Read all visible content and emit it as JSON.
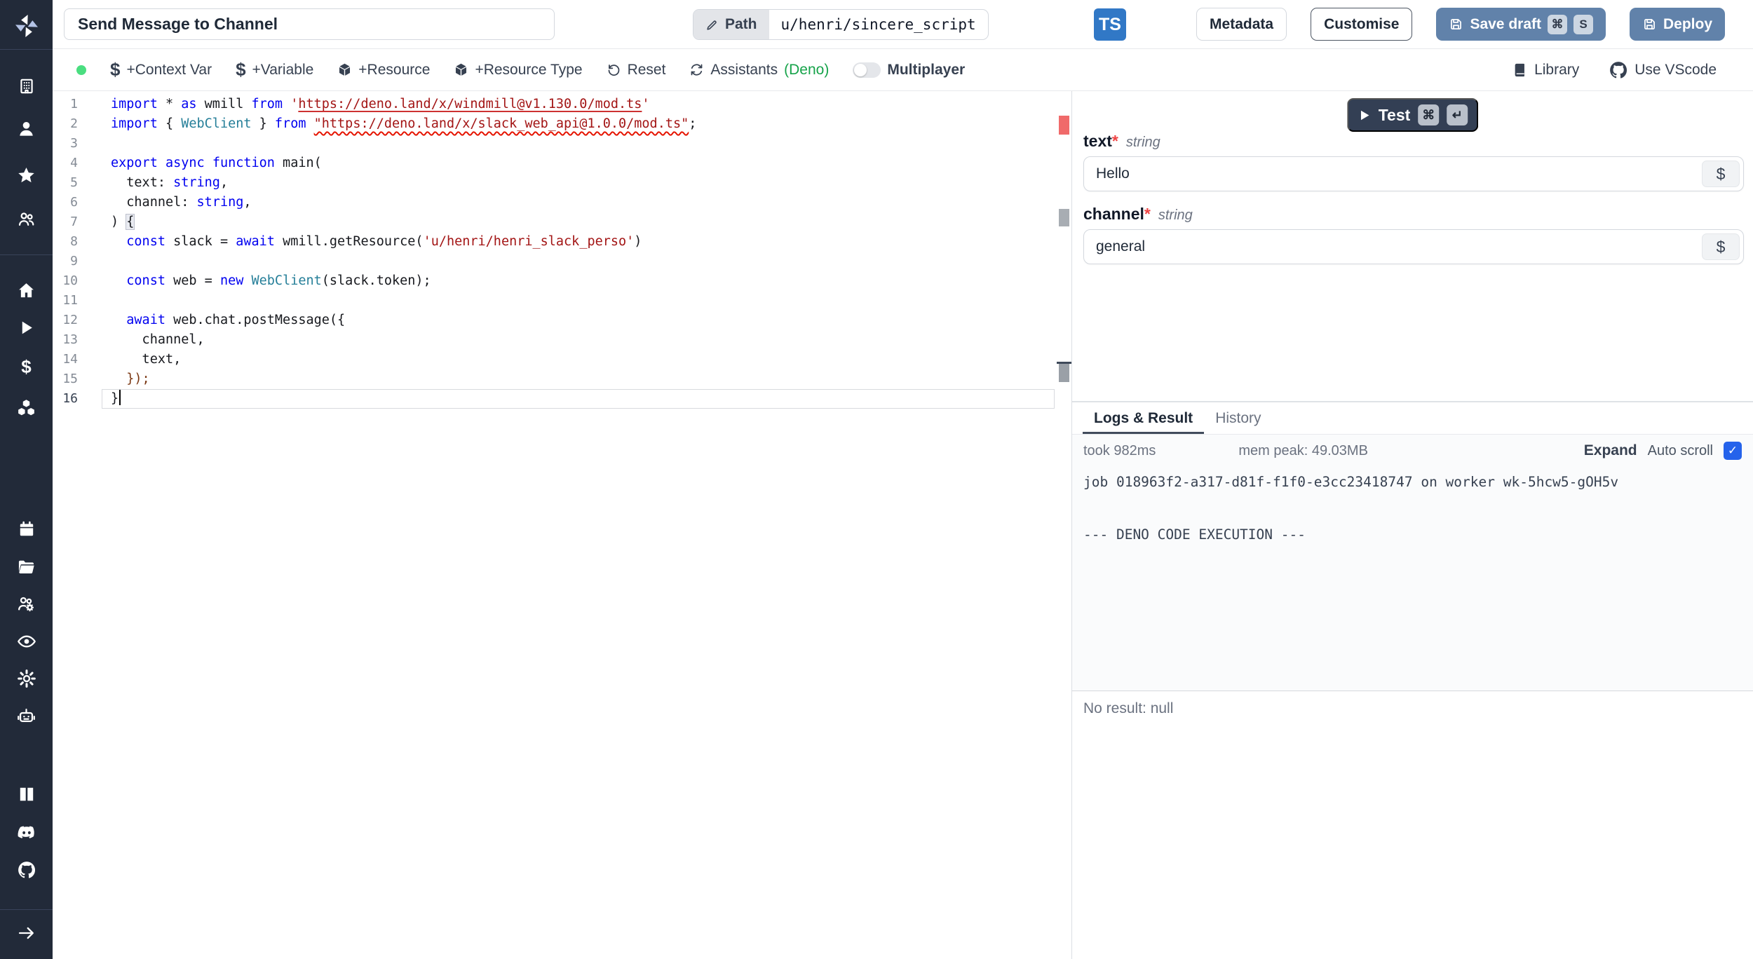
{
  "topbar": {
    "title_value": "Send Message to Channel",
    "path_label": "Path",
    "path_value": "u/henri/sincere_script",
    "lang_badge": "TS",
    "buttons": {
      "metadata": "Metadata",
      "customise": "Customise",
      "save_draft": "Save draft",
      "save_kbd": [
        "⌘",
        "S"
      ],
      "deploy": "Deploy"
    }
  },
  "toolbar": {
    "left_items": [
      {
        "name": "add-context-var",
        "icon": "dollar",
        "label": "+Context Var"
      },
      {
        "name": "add-variable",
        "icon": "dollar",
        "label": "+Variable"
      },
      {
        "name": "add-resource",
        "icon": "cube",
        "label": "+Resource"
      },
      {
        "name": "add-resource-type",
        "icon": "cube",
        "label": "+Resource Type"
      },
      {
        "name": "reset",
        "icon": "reset",
        "label": "Reset"
      },
      {
        "name": "assistants",
        "icon": "sync",
        "label": "Assistants",
        "suffix": "(Deno)"
      }
    ],
    "multiplayer_label": "Multiplayer",
    "right_items": [
      {
        "name": "library",
        "icon": "book",
        "label": "Library"
      },
      {
        "name": "use-vscode",
        "icon": "github",
        "label": "Use VScode"
      }
    ]
  },
  "editor": {
    "lines": [
      {
        "n": 1,
        "tokens": [
          {
            "t": "import",
            "c": "c-kw"
          },
          {
            "t": " * "
          },
          {
            "t": "as",
            "c": "c-kw"
          },
          {
            "t": " wmill "
          },
          {
            "t": "from",
            "c": "c-kw"
          },
          {
            "t": " "
          },
          {
            "t": "'",
            "c": "c-st"
          },
          {
            "t": "https://deno.land/x/windmill@v1.130.0/mod.ts",
            "c": "c-st us"
          },
          {
            "t": "'",
            "c": "c-st"
          }
        ]
      },
      {
        "n": 2,
        "tokens": [
          {
            "t": "import",
            "c": "c-kw"
          },
          {
            "t": " { "
          },
          {
            "t": "WebClient",
            "c": "c-ty"
          },
          {
            "t": " } "
          },
          {
            "t": "from",
            "c": "c-kw"
          },
          {
            "t": " "
          },
          {
            "t": "\"https://deno.land/x/slack_web_api@1.0.0/mod.ts\"",
            "c": "c-st uw"
          },
          {
            "t": ";"
          }
        ]
      },
      {
        "n": 3,
        "tokens": []
      },
      {
        "n": 4,
        "tokens": [
          {
            "t": "export",
            "c": "c-kw"
          },
          {
            "t": " "
          },
          {
            "t": "async",
            "c": "c-kw"
          },
          {
            "t": " "
          },
          {
            "t": "function",
            "c": "c-kw"
          },
          {
            "t": " main("
          }
        ]
      },
      {
        "n": 5,
        "tokens": [
          {
            "t": "  text: "
          },
          {
            "t": "string",
            "c": "c-kw"
          },
          {
            "t": ","
          }
        ]
      },
      {
        "n": 6,
        "tokens": [
          {
            "t": "  channel: "
          },
          {
            "t": "string",
            "c": "c-kw"
          },
          {
            "t": ","
          }
        ]
      },
      {
        "n": 7,
        "tokens": [
          {
            "t": ") "
          },
          {
            "t": "{",
            "c": "hb"
          }
        ]
      },
      {
        "n": 8,
        "tokens": [
          {
            "t": "  "
          },
          {
            "t": "const",
            "c": "c-kw"
          },
          {
            "t": " slack = "
          },
          {
            "t": "await",
            "c": "c-kw"
          },
          {
            "t": " wmill.getResource("
          },
          {
            "t": "'u/henri/henri_slack_perso'",
            "c": "c-st"
          },
          {
            "t": ")"
          }
        ]
      },
      {
        "n": 9,
        "tokens": []
      },
      {
        "n": 10,
        "tokens": [
          {
            "t": "  "
          },
          {
            "t": "const",
            "c": "c-kw"
          },
          {
            "t": " web = "
          },
          {
            "t": "new",
            "c": "c-kw"
          },
          {
            "t": " "
          },
          {
            "t": "WebClient",
            "c": "c-ty"
          },
          {
            "t": "(slack.token);"
          }
        ]
      },
      {
        "n": 11,
        "tokens": []
      },
      {
        "n": 12,
        "tokens": [
          {
            "t": "  "
          },
          {
            "t": "await",
            "c": "c-kw"
          },
          {
            "t": " web.chat.postMessage({"
          }
        ]
      },
      {
        "n": 13,
        "tokens": [
          {
            "t": "    channel,"
          }
        ]
      },
      {
        "n": 14,
        "tokens": [
          {
            "t": "    text,"
          }
        ]
      },
      {
        "n": 15,
        "tokens": [
          {
            "t": "  });",
            "c": "c-br"
          }
        ]
      },
      {
        "n": 16,
        "tokens": [
          {
            "t": "}"
          }
        ],
        "current": true,
        "cursor": true
      }
    ]
  },
  "form": {
    "test_label": "Test",
    "test_kbd": [
      "⌘",
      "↵"
    ],
    "fields": [
      {
        "name": "text",
        "required": "*",
        "type": "string",
        "value": "Hello",
        "suffix": "$"
      },
      {
        "name": "channel",
        "required": "*",
        "type": "string",
        "value": "general",
        "suffix": "$"
      }
    ]
  },
  "logs": {
    "tabs": [
      {
        "label": "Logs & Result",
        "active": true
      },
      {
        "label": "History",
        "active": false
      }
    ],
    "took": "took 982ms",
    "mem": "mem peak: 49.03MB",
    "expand_label": "Expand",
    "autoscroll_label": "Auto scroll",
    "autoscroll_checked": true,
    "lines": [
      "job 018963f2-a317-d81f-f1f0-e3cc23418747 on worker wk-5hcw5-gOH5v",
      "",
      "",
      "--- DENO CODE EXECUTION ---"
    ],
    "result": "No result: null"
  },
  "sidebar": {
    "icons": [
      "windmill-logo",
      "building",
      "user",
      "star",
      "users",
      "home",
      "play",
      "dollar",
      "cubes",
      "calendar",
      "folder",
      "users-gear",
      "eye",
      "gear",
      "robot",
      "book-open",
      "discord",
      "github",
      "arrow-right"
    ]
  },
  "colors": {
    "ts_badge": "#3178c6",
    "primary_button": "#6182aa",
    "test_button": "#333f54",
    "checkbox": "#2563eb",
    "status_green": "#4ade80",
    "deno_green": "#16a34a",
    "error_marker": "#f06a6a"
  }
}
